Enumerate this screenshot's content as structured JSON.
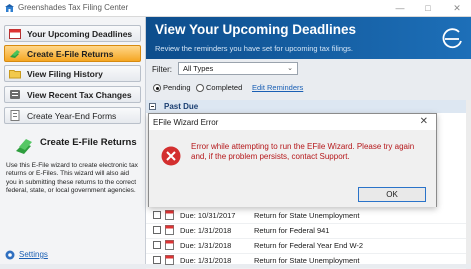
{
  "window": {
    "title": "Greenshades Tax Filing Center",
    "minimize": "—",
    "maximize": "□",
    "close": "✕"
  },
  "sidebar": {
    "items": [
      {
        "label": "Your Upcoming Deadlines",
        "icon": "calendar-icon"
      },
      {
        "label": "Create E-File Returns",
        "icon": "efile-icon",
        "active": true
      },
      {
        "label": "View Filing History",
        "icon": "folder-icon"
      },
      {
        "label": "View Recent Tax Changes",
        "icon": "changes-icon"
      },
      {
        "label": "Create Year-End Forms",
        "icon": "forms-icon"
      }
    ],
    "description_title": "Create E-File Returns",
    "description_body": "Use this E-File wizard to create electronic tax returns or E-Files. This wizard will also aid you in submitting these returns to the correct federal, state, or local government agencies.",
    "settings_label": "Settings"
  },
  "header": {
    "title": "View Your Upcoming Deadlines",
    "subtitle": "Review the reminders you have set for upcoming tax filings."
  },
  "filters": {
    "filter_label": "Filter:",
    "filter_value": "All Types",
    "status_options": [
      {
        "label": "Pending",
        "selected": true
      },
      {
        "label": "Completed",
        "selected": false
      }
    ],
    "edit_reminders_label": "Edit Reminders"
  },
  "list": {
    "group_label": "Past Due",
    "rows": [
      {
        "due": "Due: 10/31/2017",
        "return": "Return for State Unemployment"
      },
      {
        "due": "Due: 1/31/2018",
        "return": "Return for Federal 941"
      },
      {
        "due": "Due: 1/31/2018",
        "return": "Return for Federal Year End W-2"
      },
      {
        "due": "Due: 1/31/2018",
        "return": "Return for State Unemployment"
      }
    ]
  },
  "dialog": {
    "title": "EFile Wizard Error",
    "message": "Error while attempting to run the EFile Wizard.  Please try again and, if the problem persists, contact Support.",
    "ok_label": "OK"
  },
  "colors": {
    "accent": "#f5a623",
    "header": "#0d4d8c",
    "error": "#d32f2f",
    "link": "#1a5fb4"
  }
}
